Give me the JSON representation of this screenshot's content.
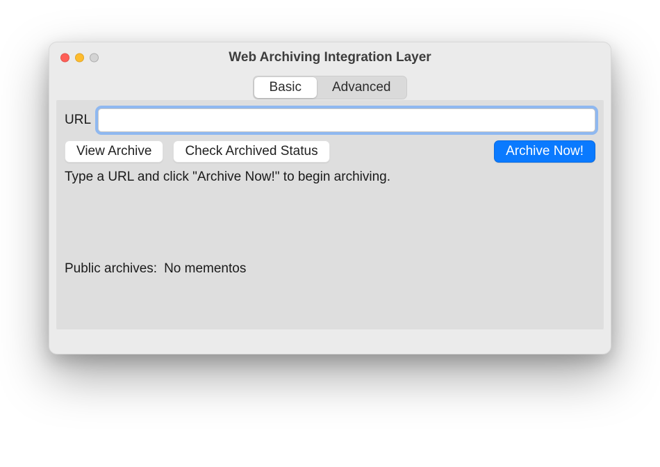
{
  "window": {
    "title": "Web Archiving Integration Layer"
  },
  "tabs": {
    "basic": "Basic",
    "advanced": "Advanced"
  },
  "url": {
    "label": "URL",
    "value": "",
    "placeholder": ""
  },
  "buttons": {
    "view_archive": "View Archive",
    "check_status": "Check Archived Status",
    "archive_now": "Archive Now!"
  },
  "hint": "Type a URL and click \"Archive Now!\" to begin archiving.",
  "public_archives": {
    "label": "Public archives:",
    "value": "No mementos"
  }
}
